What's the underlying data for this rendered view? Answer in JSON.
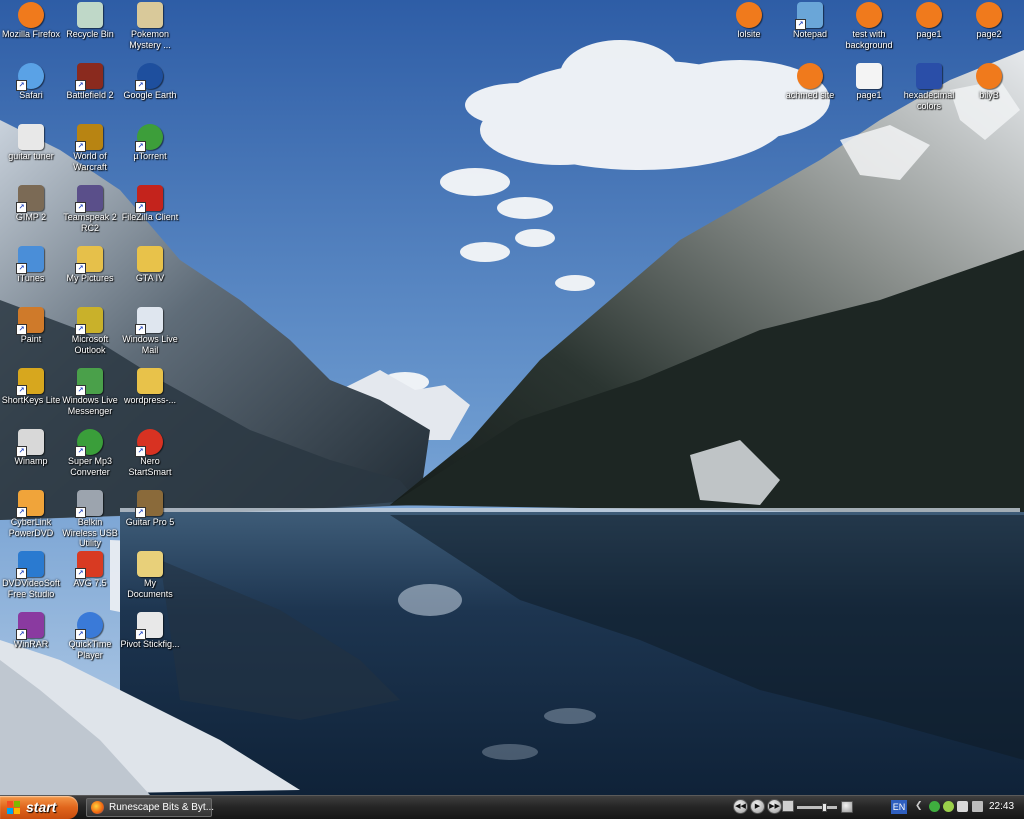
{
  "desktop": {
    "left_icons": [
      {
        "label": "Mozilla Firefox",
        "icon": "firefox-icon",
        "shortcut": false,
        "color": "#f07a1c"
      },
      {
        "label": "Recycle Bin",
        "icon": "recycle-bin-icon",
        "shortcut": false,
        "color": "#bfd8c8"
      },
      {
        "label": "Pokemon Mystery ...",
        "icon": "pokemon-icon",
        "shortcut": false,
        "color": "#d9c99a"
      },
      {
        "label": "Safari",
        "icon": "safari-icon",
        "shortcut": true,
        "color": "#5aa2e6"
      },
      {
        "label": "Battlefield 2",
        "icon": "battlefield-icon",
        "shortcut": true,
        "color": "#8a2a1e"
      },
      {
        "label": "Google Earth",
        "icon": "google-earth-icon",
        "shortcut": true,
        "color": "#1e4f9e"
      },
      {
        "label": "guitar tuner",
        "icon": "flash-icon",
        "shortcut": false,
        "color": "#e8e8e8"
      },
      {
        "label": "World of Warcraft",
        "icon": "warcraft-icon",
        "shortcut": true,
        "color": "#b88412"
      },
      {
        "label": "µTorrent",
        "icon": "utorrent-icon",
        "shortcut": true,
        "color": "#3d9e3a"
      },
      {
        "label": "GIMP 2",
        "icon": "gimp-icon",
        "shortcut": true,
        "color": "#7b6a55"
      },
      {
        "label": "Teamspeak 2 RC2",
        "icon": "teamspeak-icon",
        "shortcut": true,
        "color": "#5a4f8a"
      },
      {
        "label": "FileZilla Client",
        "icon": "filezilla-icon",
        "shortcut": true,
        "color": "#c4231c"
      },
      {
        "label": "iTunes",
        "icon": "itunes-icon",
        "shortcut": true,
        "color": "#4a8ed8"
      },
      {
        "label": "My Pictures",
        "icon": "my-pictures-icon",
        "shortcut": true,
        "color": "#e6c04a"
      },
      {
        "label": "GTA IV",
        "icon": "folder-icon",
        "shortcut": false,
        "color": "#e8c24a"
      },
      {
        "label": "Paint",
        "icon": "paint-icon",
        "shortcut": true,
        "color": "#cf7a2a"
      },
      {
        "label": "Microsoft Outlook",
        "icon": "outlook-icon",
        "shortcut": true,
        "color": "#c9b12a"
      },
      {
        "label": "Windows Live Mail",
        "icon": "live-mail-icon",
        "shortcut": true,
        "color": "#dfe6ef"
      },
      {
        "label": "ShortKeys Lite",
        "icon": "shortkeys-icon",
        "shortcut": true,
        "color": "#d7a71e"
      },
      {
        "label": "Windows Live Messenger",
        "icon": "messenger-icon",
        "shortcut": true,
        "color": "#4aa04a"
      },
      {
        "label": "wordpress-...",
        "icon": "zip-folder-icon",
        "shortcut": false,
        "color": "#e8c24a"
      },
      {
        "label": "Winamp",
        "icon": "winamp-icon",
        "shortcut": true,
        "color": "#d8d8d8"
      },
      {
        "label": "Super Mp3 Converter",
        "icon": "mp3-converter-icon",
        "shortcut": true,
        "color": "#3a9e3a"
      },
      {
        "label": "Nero StartSmart",
        "icon": "nero-icon",
        "shortcut": true,
        "color": "#d83222"
      },
      {
        "label": "CyberLink PowerDVD",
        "icon": "powerdvd-icon",
        "shortcut": true,
        "color": "#f0a43a"
      },
      {
        "label": "Belkin Wireless USB Utility",
        "icon": "wireless-icon",
        "shortcut": true,
        "color": "#9ca4ae"
      },
      {
        "label": "Guitar Pro 5",
        "icon": "guitar-pro-icon",
        "shortcut": true,
        "color": "#8a6a3a"
      },
      {
        "label": "DVDVideoSoft Free Studio",
        "icon": "dvdvideosoft-icon",
        "shortcut": true,
        "color": "#2a7ad0"
      },
      {
        "label": "AVG 7.5",
        "icon": "avg-icon",
        "shortcut": true,
        "color": "#d83a22"
      },
      {
        "label": "My Documents",
        "icon": "my-documents-icon",
        "shortcut": false,
        "color": "#e8d07a"
      },
      {
        "label": "WinRAR",
        "icon": "winrar-icon",
        "shortcut": true,
        "color": "#8a3aa0"
      },
      {
        "label": "QuickTime Player",
        "icon": "quicktime-icon",
        "shortcut": true,
        "color": "#3a7ad8"
      },
      {
        "label": "Pivot Stickfig...",
        "icon": "pivot-icon",
        "shortcut": true,
        "color": "#e8e8e8"
      }
    ],
    "right_icons": [
      {
        "label": "lolsite",
        "icon": "firefox-html-icon",
        "color": "#f07a1c"
      },
      {
        "label": "Notepad",
        "icon": "notepad-icon",
        "shortcut": true,
        "color": "#6aa6d8"
      },
      {
        "label": "test with background",
        "icon": "firefox-html-icon",
        "color": "#f07a1c"
      },
      {
        "label": "page1",
        "icon": "firefox-html-icon",
        "color": "#f07a1c"
      },
      {
        "label": "page2",
        "icon": "firefox-html-icon",
        "color": "#f07a1c"
      },
      {
        "label": "achmed site",
        "icon": "firefox-html-icon",
        "color": "#f07a1c"
      },
      {
        "label": "page1",
        "icon": "text-file-icon",
        "color": "#f4f4f4"
      },
      {
        "label": "hexadecimal colors",
        "icon": "word-document-icon",
        "color": "#2a4ea8"
      },
      {
        "label": "bilyB",
        "icon": "firefox-html-icon",
        "color": "#f07a1c"
      }
    ]
  },
  "taskbar": {
    "start_label": "start",
    "task_button_label": "Runescape Bits & Byt...",
    "language": "EN",
    "clock": "22:43",
    "volume_level": 0.7
  },
  "colors": {
    "start_orange": "#e0651c",
    "taskbar_dark": "#262626",
    "sky_top": "#2f5fa8",
    "lake": "#1e3650"
  }
}
